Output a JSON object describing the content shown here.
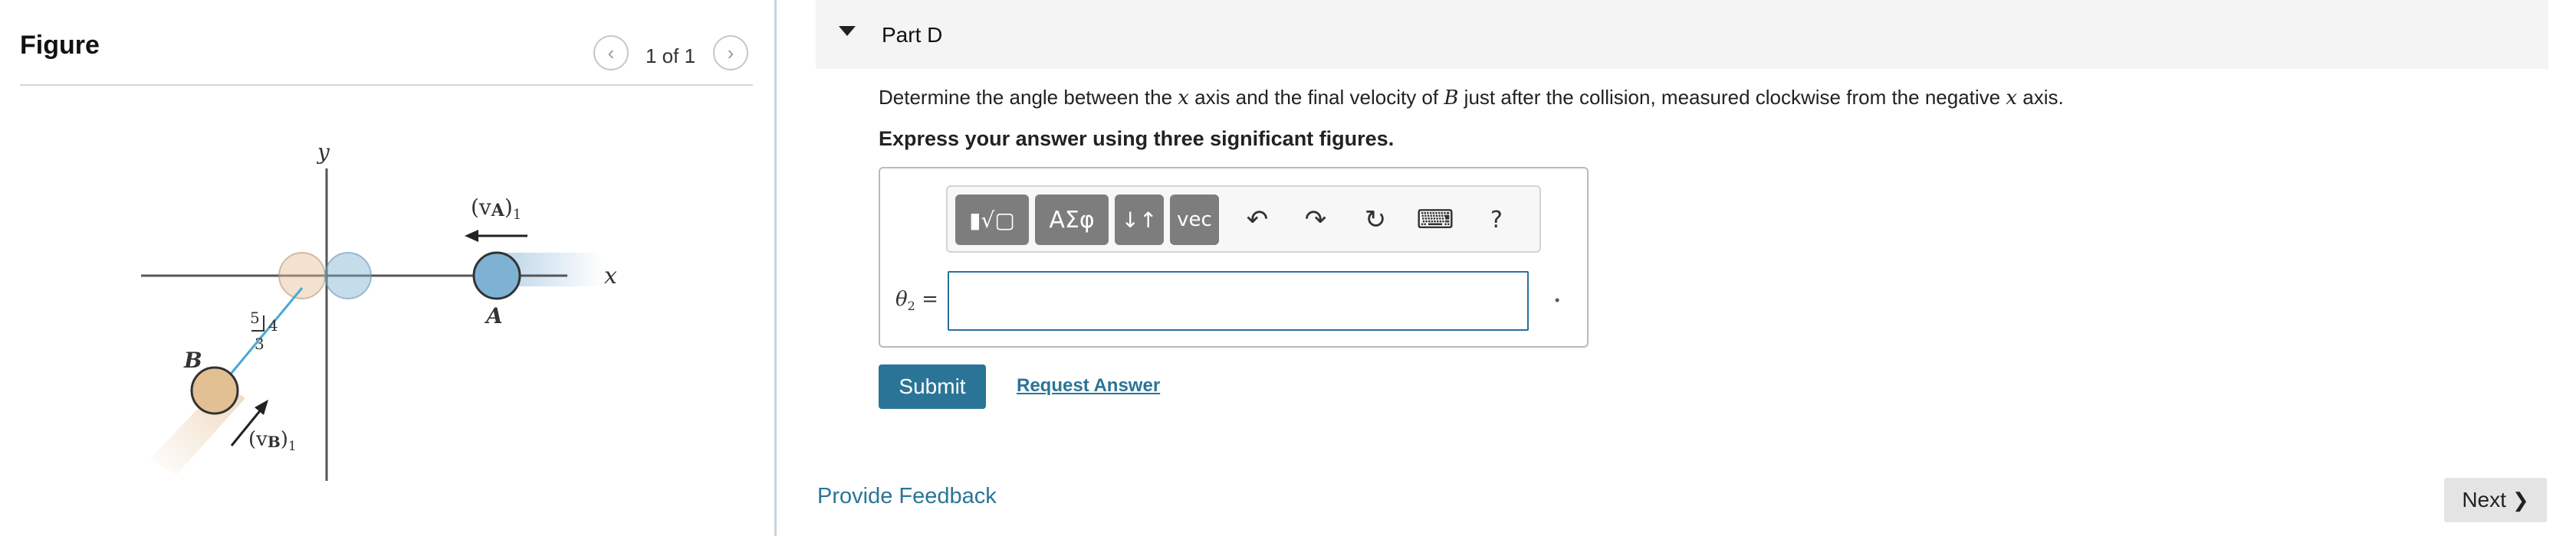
{
  "figure": {
    "title": "Figure",
    "counter": "1 of 1",
    "prev_icon": "chevron-left-icon",
    "next_icon": "chevron-right-icon",
    "diagram": {
      "axis_y": "y",
      "axis_x": "x",
      "label_vA": "(v",
      "label_vA_sub": "A",
      "label_vA_close": ")",
      "label_vA_index": "1",
      "label_A": "A",
      "label_B": "B",
      "label_vB": "(v",
      "label_vB_sub": "B",
      "label_vB_close": ")",
      "label_vB_index": "1",
      "slope_5": "5",
      "slope_4": "4",
      "slope_3": "3"
    }
  },
  "part": {
    "title": "Part D",
    "question_pre": "Determine the angle between the ",
    "question_var1": "x",
    "question_mid1": " axis and the final velocity of ",
    "question_var2": "B",
    "question_mid2": " just after the collision, measured clockwise from the negative ",
    "question_var3": "x",
    "question_post": " axis.",
    "instruction": "Express your answer using three significant figures."
  },
  "toolbar": {
    "templates_label": "▮√▢",
    "greek_label": "ΑΣφ",
    "arrows_label": "↓↑",
    "vec_label": "vec",
    "undo_icon": "undo-icon",
    "redo_icon": "redo-icon",
    "reset_icon": "reset-icon",
    "keyboard_icon": "keyboard-icon",
    "help_label": "?"
  },
  "answer": {
    "var": "θ",
    "sub": "2",
    "eq": " =",
    "value": "",
    "units_marker": "•"
  },
  "actions": {
    "submit": "Submit",
    "request_answer": "Request Answer",
    "provide_feedback": "Provide Feedback",
    "next": "Next"
  },
  "colors": {
    "accent": "#2a7597",
    "ball_A": "#7fb1d3",
    "ball_B": "#e3bf94",
    "button_gray": "#7d7d7d"
  }
}
